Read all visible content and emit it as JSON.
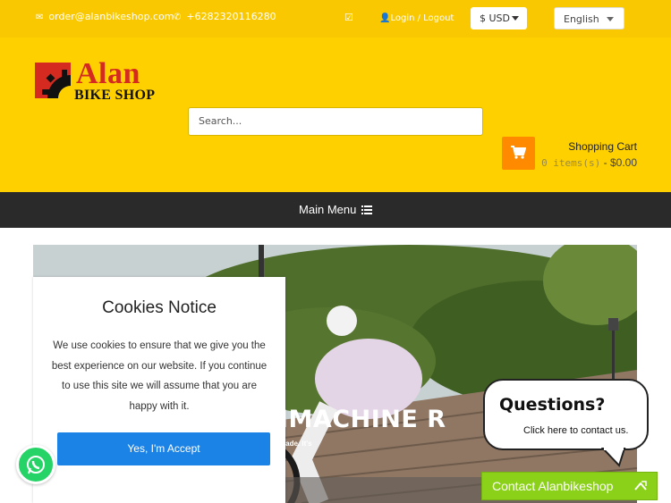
{
  "topbar": {
    "email": "order@alanbikeshop.com",
    "phone": "+6282320116280",
    "login": "Login / Logout",
    "currency": "$ USD",
    "language": "English"
  },
  "logo": {
    "line1": "Alan",
    "line2": "BIKE SHOP"
  },
  "search": {
    "placeholder": "Search..."
  },
  "cart": {
    "title": "Shopping Cart",
    "items": "0 items(s)",
    "total": "- $0.00"
  },
  "menu": {
    "label": "Main Menu"
  },
  "hero": {
    "headline": "IMACHINE R",
    "sub1": "made. It's",
    "sub2": "n."
  },
  "cookies": {
    "title": "Cookies Notice",
    "body": "We use cookies to ensure that we give you the best experience on our website. If you continue to use this site we will assume that you are happy with it.",
    "accept": "Yes, I'm Accept"
  },
  "chat": {
    "question": "Questions?",
    "cta": "Click here to contact us.",
    "bar": "Contact Alanbikeshop"
  },
  "colors": {
    "brand_yellow": "#fed000",
    "cart_orange": "#ff8a00",
    "menu_dark": "#2a2a2a",
    "accept_blue": "#1b82e6",
    "contact_green": "#8bd11a"
  },
  "icons": [
    "envelope-icon",
    "phone-icon",
    "check-square-icon",
    "user-icon",
    "caret-down-icon",
    "shopping-cart-icon",
    "menu-bars-icon",
    "whatsapp-icon",
    "chevron-up-icon"
  ]
}
